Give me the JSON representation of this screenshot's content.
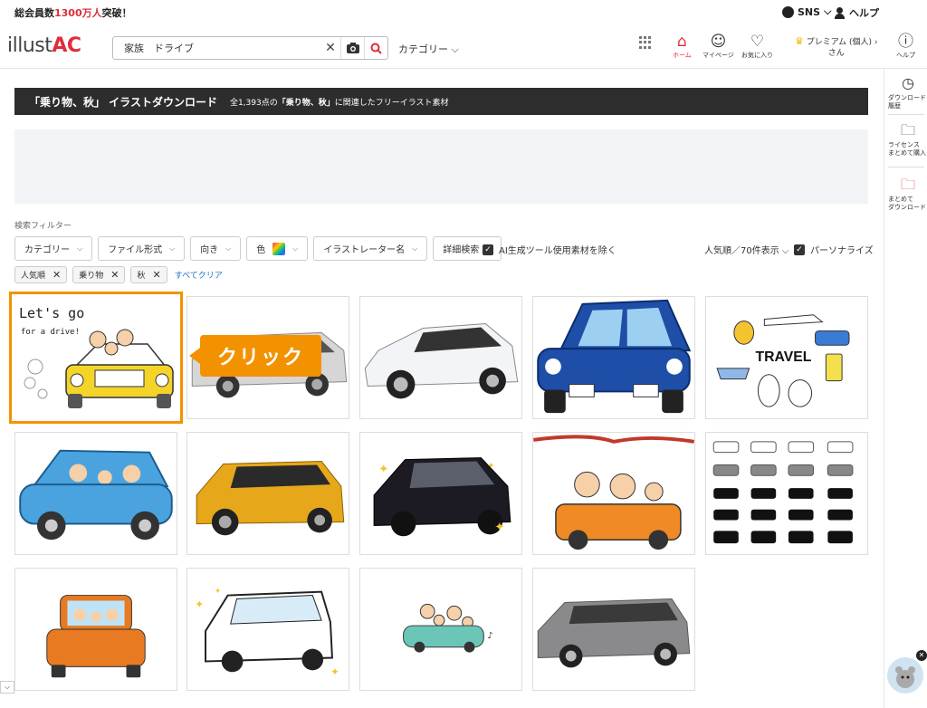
{
  "topbar": {
    "members_prefix": "総会員数",
    "members_count": "1300万人",
    "members_suffix": "突破！",
    "sns_label": "SNS",
    "help_label": "ヘルプ"
  },
  "header": {
    "logo_illust": "illust",
    "logo_ac": "AC",
    "search_value": "家族　ドライブ",
    "category_label": "カテゴリー",
    "nav": {
      "home": "ホーム",
      "mypage": "マイページ",
      "favorites": "お気に入り",
      "premium_line1": "プレミアム (個人)",
      "premium_line2": "さん",
      "help": "ヘルプ"
    }
  },
  "rail": {
    "history_l1": "ダウンロード",
    "history_l2": "履歴",
    "license_l1": "ライセンス",
    "license_l2": "まとめて購入",
    "bulk_l1": "まとめて",
    "bulk_l2": "ダウンロード"
  },
  "banner": {
    "title": "「乗り物、秋」 イラストダウンロード",
    "desc_prefix": "全1,393点の",
    "desc_keyword": "「乗り物、秋」",
    "desc_suffix": "に関連したフリーイラスト素材"
  },
  "filters": {
    "label": "検索フィルター",
    "buttons": [
      "カテゴリー",
      "ファイル形式",
      "向き",
      "色",
      "イラストレーター名",
      "詳細検索"
    ],
    "ai_exclude": "AI生成ツール使用素材を除く",
    "sort": "人気順／70件表示",
    "personalize": "パーソナライズ",
    "chips": [
      "人気順",
      "乗り物",
      "秋"
    ],
    "clear_all": "すべてクリア"
  },
  "tiles": {
    "t1_text1": "Let's go",
    "t1_text2": "for a drive!",
    "t5_text": "TRAVEL"
  },
  "callout": "クリック",
  "colors": {
    "accent": "#e02d3c",
    "callout": "#f39200",
    "banner_bg": "#2d2d2d"
  }
}
